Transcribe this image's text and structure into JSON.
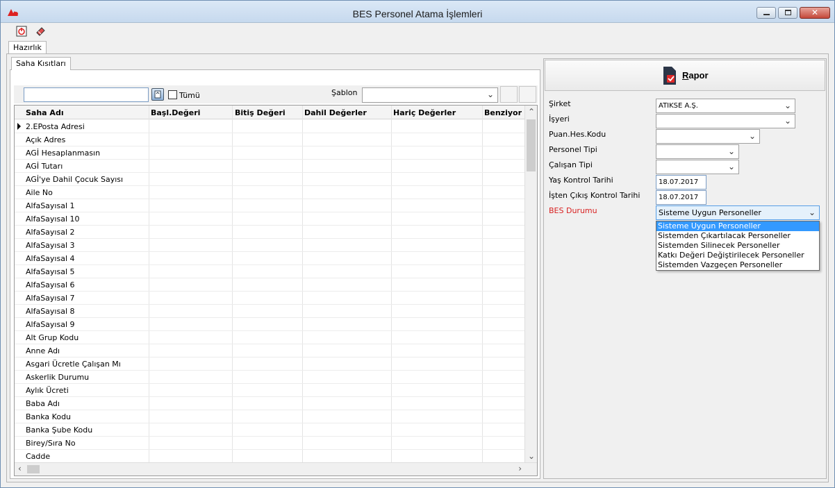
{
  "window": {
    "title": "BES Personel Atama İşlemleri"
  },
  "toolbar": {
    "icons": [
      "power-icon",
      "eraser-icon"
    ]
  },
  "tabs": {
    "top": "Hazırlık",
    "inner": "Saha Kısıtları"
  },
  "filter": {
    "search_value": "",
    "all_label": "Tümü",
    "sablon_label": "Şablon",
    "sablon_value": ""
  },
  "grid": {
    "columns": [
      "Saha Adı",
      "Başl.Değeri",
      "Bitiş Değeri",
      "Dahil Değerler",
      "Hariç Değerler",
      "Benziyor"
    ],
    "rows": [
      "2.EPosta Adresi",
      "Açık Adres",
      "AGİ Hesaplanmasın",
      "AGİ Tutarı",
      "AGİ'ye Dahil Çocuk Sayısı",
      "Aile No",
      "AlfaSayısal 1",
      "AlfaSayısal 10",
      "AlfaSayısal 2",
      "AlfaSayısal 3",
      "AlfaSayısal 4",
      "AlfaSayısal 5",
      "AlfaSayısal 6",
      "AlfaSayısal 7",
      "AlfaSayısal 8",
      "AlfaSayısal 9",
      "Alt Grup Kodu",
      "Anne Adı",
      "Asgari Ücretle Çalışan Mı",
      "Askerlik Durumu",
      "Aylık Ücreti",
      "Baba Adı",
      "Banka Kodu",
      "Banka Şube Kodu",
      "Birey/Sıra No",
      "Cadde"
    ]
  },
  "rapor": {
    "label": "Rapor"
  },
  "form": {
    "sirket_label": "Şirket",
    "sirket_value": "ATIKSE A.Ş.",
    "isyeri_label": "İşyeri",
    "isyeri_value": "",
    "puan_label": "Puan.Hes.Kodu",
    "puan_value": "",
    "personel_tipi_label": "Personel Tipi",
    "personel_tipi_value": "",
    "calisan_tipi_label": "Çalışan Tipi",
    "calisan_tipi_value": "",
    "yas_label": "Yaş Kontrol Tarihi",
    "yas_value": "18.07.2017",
    "isten_label": "İşten Çıkış Kontrol Tarihi",
    "isten_value": "18.07.2017",
    "bes_label": "BES Durumu",
    "bes_value": "Sisteme Uygun Personeller",
    "bes_options": [
      "Sisteme Uygun Personeller",
      "Sistemden Çıkartılacak Personeller",
      "Sistemden Silinecek Personeller",
      "Katkı Değeri Değiştirilecek Personeller",
      "Sistemden Vazgeçen Personeller"
    ]
  },
  "colors": {
    "accent": "#3399ff",
    "required_label": "#d81f1f"
  }
}
